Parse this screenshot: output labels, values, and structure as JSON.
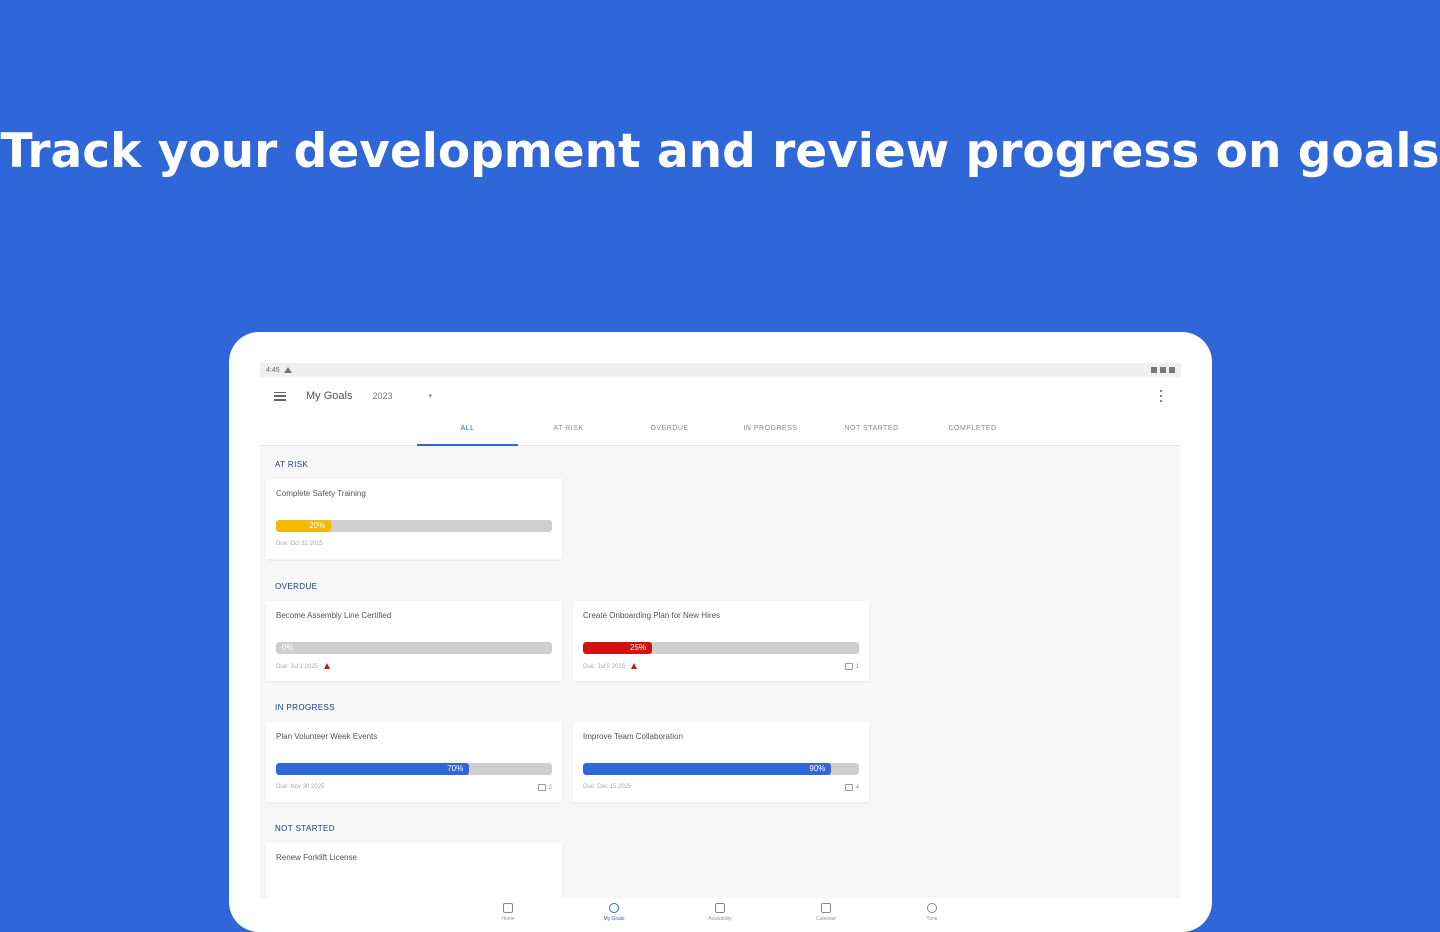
{
  "promo": {
    "headline": "Track your development and review progress on goals"
  },
  "colors": {
    "background": "#2f66d8",
    "accent": "#2f66d8",
    "at_risk": "#f5b800",
    "overdue": "#d41111",
    "in_progress": "#2f66d8"
  },
  "status_bar": {
    "time": "4:45"
  },
  "app_bar": {
    "menu_icon": "menu-icon",
    "title": "My Goals",
    "year": "2023",
    "more_icon": "more-vertical-icon"
  },
  "tabs": [
    {
      "label": "ALL",
      "active": true
    },
    {
      "label": "AT RISK",
      "active": false
    },
    {
      "label": "OVERDUE",
      "active": false
    },
    {
      "label": "IN PROGRESS",
      "active": false
    },
    {
      "label": "NOT STARTED",
      "active": false
    },
    {
      "label": "COMPLETED",
      "active": false
    }
  ],
  "sections": {
    "at_risk": {
      "label": "AT RISK",
      "cards": [
        {
          "title": "Complete Safety Training",
          "progress": 20,
          "progress_text": "20%",
          "due": "Due: Oct 31 2025",
          "color": "#f5b800"
        }
      ]
    },
    "overdue": {
      "label": "OVERDUE",
      "cards": [
        {
          "title": "Become Assembly Line Certified",
          "progress": 0,
          "progress_text": "0%",
          "due": "Due: Jul 1 2025",
          "alert": true,
          "color": "#d41111"
        },
        {
          "title": "Create Onboarding Plan for New Hires",
          "progress": 25,
          "progress_text": "25%",
          "due": "Due: Jul 5 2025",
          "alert": true,
          "comments": "1",
          "color": "#d41111"
        }
      ]
    },
    "in_progress": {
      "label": "IN PROGRESS",
      "cards": [
        {
          "title": "Plan Volunteer Week Events",
          "progress": 70,
          "progress_text": "70%",
          "due": "Due: Nov 30 2025",
          "comments": "2",
          "color": "#2f66d8"
        },
        {
          "title": "Improve Team Collaboration",
          "progress": 90,
          "progress_text": "90%",
          "due": "Due: Dec 15 2025",
          "comments": "4",
          "color": "#2f66d8"
        }
      ]
    },
    "not_started": {
      "label": "NOT STARTED",
      "cards": [
        {
          "title": "Renew Forklift License"
        }
      ]
    }
  },
  "bottom_nav": [
    {
      "label": "Home",
      "icon": "home-icon",
      "active": false
    },
    {
      "label": "My Goals",
      "icon": "goals-icon",
      "active": true
    },
    {
      "label": "Availability",
      "icon": "availability-icon",
      "active": false
    },
    {
      "label": "Calendar",
      "icon": "calendar-icon",
      "active": false
    },
    {
      "label": "Time",
      "icon": "clock-icon",
      "active": false
    }
  ]
}
